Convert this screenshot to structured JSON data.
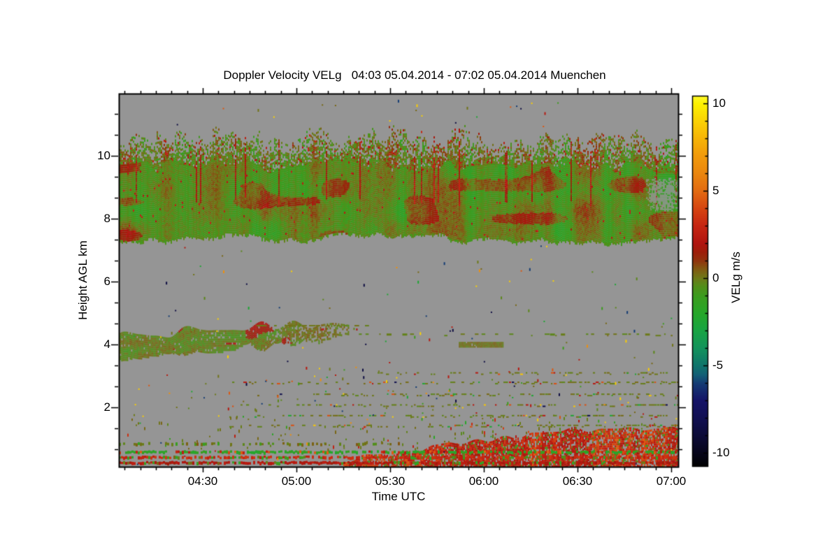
{
  "title": "Doppler Velocity VELg   04:03 05.04.2014 - 07:02 05.04.2014 Muenchen",
  "chart_data": {
    "type": "heatmap",
    "title": "Doppler Velocity VELg   04:03 05.04.2014 - 07:02 05.04.2014 Muenchen",
    "instrument_quantity": "Doppler Velocity VELg",
    "site": "Muenchen",
    "date": "05.04.2014",
    "xlabel": "Time UTC",
    "ylabel": "Height AGL km",
    "colorbar_label": "VELg m/s",
    "x_start": "04:03",
    "x_end": "07:02",
    "x_ticks": [
      "04:30",
      "05:00",
      "05:30",
      "06:00",
      "06:30",
      "07:00"
    ],
    "x_minor_interval_min": 5,
    "y_ticks": [
      2,
      4,
      6,
      8,
      10
    ],
    "y_minor_per_major": 3,
    "y_range_km": [
      0.1,
      12.0
    ],
    "colorbar_ticks": [
      10,
      5,
      0,
      -5,
      -10
    ],
    "colorbar_minor_interval": 1,
    "colorbar_range": [
      -10.8,
      10.8
    ],
    "no_data_color": "#959595",
    "grid": false,
    "legend_position": "right-colorbar",
    "colormap_stops": [
      [
        -10.8,
        "#000000"
      ],
      [
        -10,
        "#06051a"
      ],
      [
        -9,
        "#0c0b38"
      ],
      [
        -8,
        "#111052"
      ],
      [
        -7,
        "#141367"
      ],
      [
        -6,
        "#143c74"
      ],
      [
        -5.5,
        "#126076"
      ],
      [
        -5,
        "#0f746c"
      ],
      [
        -4,
        "#13935c"
      ],
      [
        -3,
        "#18a444"
      ],
      [
        -2,
        "#26a72a"
      ],
      [
        -1,
        "#3c9c1e"
      ],
      [
        -0.5,
        "#50901a"
      ],
      [
        0,
        "#6d7a19"
      ],
      [
        0.5,
        "#805c12"
      ],
      [
        1,
        "#90340d"
      ],
      [
        1.5,
        "#9e1e0a"
      ],
      [
        2,
        "#b01510"
      ],
      [
        3,
        "#c62512"
      ],
      [
        4,
        "#d64511"
      ],
      [
        5,
        "#e26b11"
      ],
      [
        6,
        "#ea860e"
      ],
      [
        7,
        "#f19a0b"
      ],
      [
        8,
        "#f6b407"
      ],
      [
        9,
        "#fad204"
      ],
      [
        10,
        "#fdf100"
      ],
      [
        10.8,
        "#ffff4d"
      ]
    ],
    "seed": 1337,
    "features": {
      "cirrus_cloud_deck": {
        "t_range": [
          "04:03",
          "07:02"
        ],
        "top_km_mean": 10.5,
        "top_km_var": 0.45,
        "grass_km_mean": 9.7,
        "base_km_mean": 7.45,
        "base_km_var": 0.25,
        "velocity_mean": -0.5,
        "velocity_spread": 1.1,
        "red_streak_fraction": 0.05,
        "gray_notch": {
          "t_range": [
            "06:52",
            "07:02"
          ],
          "km_range": [
            8.25,
            9.3
          ]
        }
      },
      "mid_level_layer": {
        "t_range": [
          "04:03",
          "05:20"
        ],
        "km_center_start": 3.95,
        "km_center_end": 4.45,
        "km_half_thickness": 0.33,
        "velocity_mean": -0.1,
        "top_line_km": 4.62,
        "top_line_t_range": [
          "04:45",
          "05:22"
        ]
      },
      "thin_layer_line": {
        "km": 4.35,
        "t_range": [
          "05:20",
          "07:02"
        ],
        "velocity_mean": -0.1
      },
      "thin_layer_segment": {
        "km_range": [
          3.93,
          4.08
        ],
        "t_range": [
          "05:52",
          "06:06"
        ],
        "velocity_mean": 0.1
      },
      "dotted_rows_km": [
        3.12,
        2.82,
        2.44,
        2.1,
        1.76,
        1.45
      ],
      "boundary_layer": {
        "sparse_top_km": 1.8,
        "wedge_t_start": "05:15",
        "wedge_top_km_start": 0.35,
        "wedge_top_km_end": 1.3,
        "velocity_mean": 3.0
      },
      "surface_stripes": [
        {
          "km": 0.9,
          "coverage": 0.3,
          "velocity": 0.0,
          "note": "sparse olive dashes"
        },
        {
          "km": 0.64,
          "coverage": 0.8,
          "velocity": -1.6,
          "note": "green stripe with red bits"
        },
        {
          "km": 0.47,
          "coverage": 0.75,
          "velocity": 3.0,
          "note": "orange-red mixed stripe"
        },
        {
          "km": 0.3,
          "coverage": 0.85,
          "velocity": 2.1,
          "note": "red stripe"
        },
        {
          "km": 0.12,
          "coverage": 0.9,
          "velocity": 2.8,
          "note": "dense orange band at surface"
        }
      ],
      "scattered_pixels": {
        "count": 260
      }
    }
  }
}
